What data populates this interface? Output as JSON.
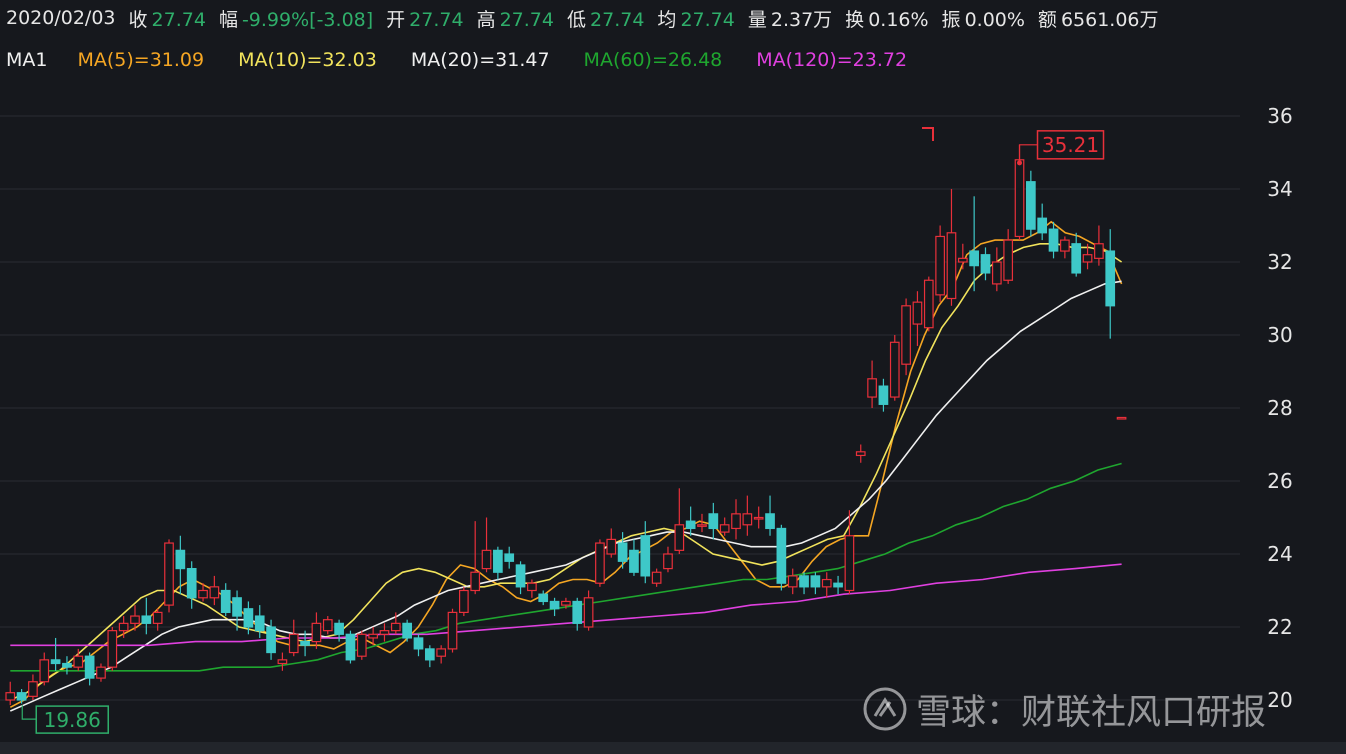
{
  "info": {
    "date": "2020/02/03",
    "fields": [
      {
        "label": "收",
        "value": "27.74",
        "tone": "green"
      },
      {
        "label": "幅",
        "value": "-9.99%[-3.08]",
        "tone": "green"
      },
      {
        "label": "开",
        "value": "27.74",
        "tone": "green"
      },
      {
        "label": "高",
        "value": "27.74",
        "tone": "green"
      },
      {
        "label": "低",
        "value": "27.74",
        "tone": "green"
      },
      {
        "label": "均",
        "value": "27.74",
        "tone": "green"
      },
      {
        "label": "量",
        "value": "2.37万",
        "tone": "white"
      },
      {
        "label": "换",
        "value": "0.16%",
        "tone": "white"
      },
      {
        "label": "振",
        "value": "0.00%",
        "tone": "white"
      },
      {
        "label": "额",
        "value": "6561.06万",
        "tone": "white"
      }
    ]
  },
  "ma_bar": {
    "name": "MA1",
    "items": [
      {
        "text": "MA(5)=31.09",
        "color": "#f5a623"
      },
      {
        "text": "MA(10)=32.03",
        "color": "#f1e35c"
      },
      {
        "text": "MA(20)=31.47",
        "color": "#f0f0f0"
      },
      {
        "text": "MA(60)=26.48",
        "color": "#1fa62f"
      },
      {
        "text": "MA(120)=23.72",
        "color": "#e040e0"
      }
    ]
  },
  "watermark": {
    "text": "雪球：财联社风口研报"
  },
  "colors": {
    "up": "#e8303a",
    "down": "#3ec8c8",
    "background": "#16181d",
    "grid": "#2a2d33"
  },
  "chart_data": {
    "type": "candlestick",
    "ylim": [
      19.5,
      36.5
    ],
    "y_ticks": [
      20,
      22,
      24,
      26,
      28,
      30,
      32,
      34,
      36
    ],
    "high_label": "35.21",
    "low_label": "19.86",
    "candles": [
      {
        "o": 20.0,
        "c": 20.2,
        "h": 20.5,
        "l": 19.86
      },
      {
        "o": 20.2,
        "c": 20.0,
        "h": 20.3,
        "l": 19.9
      },
      {
        "o": 20.1,
        "c": 20.5,
        "h": 20.7,
        "l": 20.0
      },
      {
        "o": 20.5,
        "c": 21.1,
        "h": 21.3,
        "l": 20.4
      },
      {
        "o": 21.1,
        "c": 21.0,
        "h": 21.7,
        "l": 20.8
      },
      {
        "o": 21.0,
        "c": 20.9,
        "h": 21.2,
        "l": 20.7
      },
      {
        "o": 20.9,
        "c": 21.2,
        "h": 21.4,
        "l": 20.8
      },
      {
        "o": 21.2,
        "c": 20.6,
        "h": 21.3,
        "l": 20.4
      },
      {
        "o": 20.6,
        "c": 20.9,
        "h": 21.0,
        "l": 20.5
      },
      {
        "o": 20.9,
        "c": 21.9,
        "h": 22.0,
        "l": 20.8
      },
      {
        "o": 21.9,
        "c": 22.1,
        "h": 22.3,
        "l": 21.7
      },
      {
        "o": 22.1,
        "c": 22.3,
        "h": 22.6,
        "l": 21.9
      },
      {
        "o": 22.3,
        "c": 22.1,
        "h": 22.8,
        "l": 21.8
      },
      {
        "o": 22.1,
        "c": 22.4,
        "h": 22.5,
        "l": 21.9
      },
      {
        "o": 22.6,
        "c": 24.3,
        "h": 24.4,
        "l": 22.4
      },
      {
        "o": 24.1,
        "c": 23.6,
        "h": 24.5,
        "l": 22.9
      },
      {
        "o": 23.6,
        "c": 22.8,
        "h": 23.8,
        "l": 22.5
      },
      {
        "o": 22.8,
        "c": 23.0,
        "h": 23.2,
        "l": 22.7
      },
      {
        "o": 22.8,
        "c": 23.1,
        "h": 23.4,
        "l": 22.6
      },
      {
        "o": 23.0,
        "c": 22.4,
        "h": 23.2,
        "l": 22.3
      },
      {
        "o": 22.8,
        "c": 22.3,
        "h": 23.0,
        "l": 21.9
      },
      {
        "o": 22.5,
        "c": 22.0,
        "h": 22.7,
        "l": 21.8
      },
      {
        "o": 22.3,
        "c": 21.9,
        "h": 22.6,
        "l": 21.7
      },
      {
        "o": 22.0,
        "c": 21.3,
        "h": 22.2,
        "l": 21.1
      },
      {
        "o": 21.0,
        "c": 21.1,
        "h": 21.3,
        "l": 20.8
      },
      {
        "o": 21.3,
        "c": 21.8,
        "h": 22.2,
        "l": 21.2
      },
      {
        "o": 21.6,
        "c": 21.5,
        "h": 21.9,
        "l": 21.2
      },
      {
        "o": 21.6,
        "c": 22.1,
        "h": 22.4,
        "l": 21.4
      },
      {
        "o": 21.9,
        "c": 22.2,
        "h": 22.3,
        "l": 21.8
      },
      {
        "o": 22.1,
        "c": 21.8,
        "h": 22.2,
        "l": 21.6
      },
      {
        "o": 21.8,
        "c": 21.1,
        "h": 21.9,
        "l": 21.0
      },
      {
        "o": 21.2,
        "c": 21.8,
        "h": 21.9,
        "l": 21.1
      },
      {
        "o": 21.7,
        "c": 21.8,
        "h": 22.0,
        "l": 21.5
      },
      {
        "o": 21.8,
        "c": 21.9,
        "h": 22.1,
        "l": 21.6
      },
      {
        "o": 21.9,
        "c": 22.1,
        "h": 22.4,
        "l": 21.8
      },
      {
        "o": 22.1,
        "c": 21.7,
        "h": 22.2,
        "l": 21.6
      },
      {
        "o": 21.7,
        "c": 21.4,
        "h": 21.8,
        "l": 21.2
      },
      {
        "o": 21.4,
        "c": 21.1,
        "h": 21.5,
        "l": 20.9
      },
      {
        "o": 21.2,
        "c": 21.4,
        "h": 21.5,
        "l": 21.0
      },
      {
        "o": 21.4,
        "c": 22.4,
        "h": 22.5,
        "l": 21.3
      },
      {
        "o": 22.4,
        "c": 23.0,
        "h": 23.1,
        "l": 22.3
      },
      {
        "o": 23.0,
        "c": 23.5,
        "h": 24.9,
        "l": 22.9
      },
      {
        "o": 23.6,
        "c": 24.1,
        "h": 25.0,
        "l": 23.5
      },
      {
        "o": 24.1,
        "c": 23.5,
        "h": 24.2,
        "l": 23.3
      },
      {
        "o": 24.0,
        "c": 23.8,
        "h": 24.2,
        "l": 23.6
      },
      {
        "o": 23.7,
        "c": 23.1,
        "h": 23.8,
        "l": 22.9
      },
      {
        "o": 23.0,
        "c": 23.2,
        "h": 23.3,
        "l": 22.8
      },
      {
        "o": 22.9,
        "c": 22.7,
        "h": 23.0,
        "l": 22.6
      },
      {
        "o": 22.7,
        "c": 22.5,
        "h": 22.8,
        "l": 22.3
      },
      {
        "o": 22.6,
        "c": 22.7,
        "h": 22.8,
        "l": 22.5
      },
      {
        "o": 22.7,
        "c": 22.1,
        "h": 22.8,
        "l": 21.9
      },
      {
        "o": 22.0,
        "c": 22.8,
        "h": 23.0,
        "l": 21.9
      },
      {
        "o": 23.2,
        "c": 24.3,
        "h": 24.4,
        "l": 23.1
      },
      {
        "o": 24.0,
        "c": 24.4,
        "h": 24.7,
        "l": 23.9
      },
      {
        "o": 24.3,
        "c": 23.8,
        "h": 24.6,
        "l": 23.6
      },
      {
        "o": 24.1,
        "c": 23.5,
        "h": 24.4,
        "l": 23.4
      },
      {
        "o": 24.5,
        "c": 23.4,
        "h": 24.9,
        "l": 23.2
      },
      {
        "o": 23.2,
        "c": 23.5,
        "h": 23.6,
        "l": 23.1
      },
      {
        "o": 23.6,
        "c": 24.0,
        "h": 24.2,
        "l": 23.5
      },
      {
        "o": 24.1,
        "c": 24.8,
        "h": 25.8,
        "l": 24.0
      },
      {
        "o": 24.9,
        "c": 24.7,
        "h": 25.3,
        "l": 24.5
      },
      {
        "o": 24.8,
        "c": 24.8,
        "h": 25.1,
        "l": 24.6
      },
      {
        "o": 25.1,
        "c": 24.7,
        "h": 25.4,
        "l": 24.4
      },
      {
        "o": 24.6,
        "c": 24.8,
        "h": 25.0,
        "l": 24.5
      },
      {
        "o": 24.7,
        "c": 25.1,
        "h": 25.5,
        "l": 24.4
      },
      {
        "o": 24.8,
        "c": 25.1,
        "h": 25.6,
        "l": 24.5
      },
      {
        "o": 25.0,
        "c": 25.0,
        "h": 25.3,
        "l": 24.7
      },
      {
        "o": 25.1,
        "c": 24.7,
        "h": 25.6,
        "l": 24.5
      },
      {
        "o": 24.7,
        "c": 23.2,
        "h": 24.8,
        "l": 23.0
      },
      {
        "o": 23.1,
        "c": 23.4,
        "h": 23.6,
        "l": 22.9
      },
      {
        "o": 23.4,
        "c": 23.1,
        "h": 23.5,
        "l": 22.9
      },
      {
        "o": 23.4,
        "c": 23.1,
        "h": 23.5,
        "l": 22.9
      },
      {
        "o": 23.1,
        "c": 23.3,
        "h": 23.5,
        "l": 22.8
      },
      {
        "o": 23.2,
        "c": 23.1,
        "h": 23.4,
        "l": 22.9
      },
      {
        "o": 23.0,
        "c": 24.5,
        "h": 25.2,
        "l": 22.9
      },
      {
        "o": 26.7,
        "c": 26.8,
        "h": 27.0,
        "l": 26.5
      },
      {
        "o": 28.3,
        "c": 28.8,
        "h": 29.3,
        "l": 28.0
      },
      {
        "o": 28.6,
        "c": 28.1,
        "h": 28.8,
        "l": 27.9
      },
      {
        "o": 28.3,
        "c": 29.8,
        "h": 30.0,
        "l": 28.2
      },
      {
        "o": 29.2,
        "c": 30.8,
        "h": 31.0,
        "l": 28.9
      },
      {
        "o": 30.3,
        "c": 30.9,
        "h": 31.2,
        "l": 29.7
      },
      {
        "o": 30.2,
        "c": 31.5,
        "h": 31.6,
        "l": 30.1
      },
      {
        "o": 31.1,
        "c": 32.7,
        "h": 33.0,
        "l": 30.9
      },
      {
        "o": 31.0,
        "c": 32.8,
        "h": 34.0,
        "l": 30.8
      },
      {
        "o": 32.0,
        "c": 32.1,
        "h": 32.5,
        "l": 31.8
      },
      {
        "o": 32.3,
        "c": 31.9,
        "h": 33.8,
        "l": 31.2
      },
      {
        "o": 32.2,
        "c": 31.7,
        "h": 32.4,
        "l": 31.5
      },
      {
        "o": 31.4,
        "c": 32.0,
        "h": 32.4,
        "l": 31.2
      },
      {
        "o": 31.5,
        "c": 32.6,
        "h": 32.9,
        "l": 31.4
      },
      {
        "o": 32.7,
        "c": 34.8,
        "h": 35.21,
        "l": 32.6
      },
      {
        "o": 34.2,
        "c": 32.9,
        "h": 34.5,
        "l": 32.7
      },
      {
        "o": 33.2,
        "c": 32.8,
        "h": 33.6,
        "l": 32.6
      },
      {
        "o": 32.9,
        "c": 32.3,
        "h": 33.1,
        "l": 32.1
      },
      {
        "o": 32.3,
        "c": 32.6,
        "h": 32.7,
        "l": 32.1
      },
      {
        "o": 32.5,
        "c": 31.7,
        "h": 32.8,
        "l": 31.6
      },
      {
        "o": 32.0,
        "c": 32.2,
        "h": 32.5,
        "l": 31.8
      },
      {
        "o": 32.1,
        "c": 32.5,
        "h": 33.0,
        "l": 31.9
      },
      {
        "o": 32.3,
        "c": 30.8,
        "h": 32.9,
        "l": 29.9
      },
      {
        "o": 27.74,
        "c": 27.74,
        "h": 27.74,
        "l": 27.74
      }
    ],
    "ma": [
      {
        "name": "MA(5)",
        "color": "#f5a623",
        "values": [
          19.8,
          20.0,
          20.4,
          20.7,
          20.9,
          21.0,
          21.3,
          21.6,
          21.8,
          22.0,
          22.3,
          22.7,
          23.1,
          23.3,
          23.1,
          22.9,
          22.6,
          22.2,
          21.9,
          21.6,
          21.5,
          21.5,
          21.5,
          21.4,
          21.6,
          21.7,
          21.5,
          21.3,
          21.6,
          22.0,
          22.6,
          23.3,
          23.7,
          23.6,
          23.3,
          23.1,
          22.8,
          22.7,
          22.9,
          23.2,
          23.3,
          23.3,
          23.2,
          23.5,
          23.9,
          24.1,
          24.3,
          24.6,
          24.7,
          24.9,
          24.8,
          24.3,
          23.8,
          23.3,
          23.1,
          23.1,
          23.3,
          23.8,
          24.2,
          24.4,
          24.5,
          24.5,
          26.0,
          27.6,
          29.0,
          30.0,
          30.8,
          31.3,
          32.2,
          32.5,
          32.6,
          32.6,
          32.6,
          32.8,
          33.1,
          32.8,
          32.7,
          32.5,
          32.3,
          31.4
        ]
      },
      {
        "name": "MA(10)",
        "color": "#f1e35c",
        "values": [
          20.0,
          20.2,
          20.5,
          20.8,
          21.2,
          21.6,
          22.0,
          22.4,
          22.8,
          23.0,
          23.0,
          22.8,
          22.6,
          22.3,
          22.0,
          21.9,
          21.8,
          21.7,
          21.6,
          21.7,
          21.8,
          22.2,
          22.7,
          23.2,
          23.5,
          23.6,
          23.5,
          23.3,
          23.1,
          23.1,
          23.2,
          23.2,
          23.2,
          23.3,
          23.6,
          23.9,
          24.1,
          24.3,
          24.5,
          24.6,
          24.7,
          24.6,
          24.3,
          24.0,
          23.9,
          23.8,
          23.7,
          23.8,
          24.0,
          24.2,
          24.4,
          24.5,
          25.3,
          26.2,
          27.2,
          28.2,
          29.3,
          30.2,
          30.8,
          31.5,
          31.9,
          32.2,
          32.4,
          32.5,
          32.5,
          32.4,
          32.4,
          32.3,
          32.0
        ]
      },
      {
        "name": "MA(20)",
        "color": "#f0f0f0",
        "values": [
          19.7,
          19.9,
          20.1,
          20.3,
          20.5,
          20.7,
          20.9,
          21.2,
          21.5,
          21.8,
          22.0,
          22.1,
          22.2,
          22.2,
          22.2,
          22.1,
          21.9,
          21.8,
          21.8,
          21.7,
          21.7,
          21.9,
          22.1,
          22.3,
          22.6,
          22.8,
          23.0,
          23.1,
          23.2,
          23.3,
          23.4,
          23.5,
          23.6,
          23.7,
          23.9,
          24.1,
          24.3,
          24.4,
          24.5,
          24.6,
          24.6,
          24.5,
          24.4,
          24.3,
          24.2,
          24.2,
          24.2,
          24.3,
          24.5,
          24.7,
          25.1,
          25.5,
          26.0,
          26.6,
          27.2,
          27.8,
          28.3,
          28.8,
          29.3,
          29.7,
          30.1,
          30.4,
          30.7,
          31.0,
          31.2,
          31.4,
          31.47
        ]
      },
      {
        "name": "MA(60)",
        "color": "#1fa62f",
        "values": [
          20.8,
          20.8,
          20.8,
          20.8,
          20.8,
          20.8,
          20.8,
          20.8,
          20.8,
          20.9,
          20.9,
          20.9,
          21.0,
          21.1,
          21.3,
          21.4,
          21.6,
          21.8,
          21.9,
          22.1,
          22.2,
          22.3,
          22.4,
          22.5,
          22.6,
          22.7,
          22.8,
          22.9,
          23.0,
          23.1,
          23.2,
          23.3,
          23.3,
          23.4,
          23.5,
          23.6,
          23.8,
          24.0,
          24.3,
          24.5,
          24.8,
          25.0,
          25.3,
          25.5,
          25.8,
          26.0,
          26.3,
          26.48
        ]
      },
      {
        "name": "MA(120)",
        "color": "#e040e0",
        "values": [
          21.5,
          21.5,
          21.5,
          21.5,
          21.6,
          21.6,
          21.7,
          21.7,
          21.8,
          21.8,
          21.9,
          22.0,
          22.1,
          22.2,
          22.3,
          22.4,
          22.6,
          22.7,
          22.9,
          23.0,
          23.2,
          23.3,
          23.5,
          23.6,
          23.72
        ]
      }
    ]
  }
}
